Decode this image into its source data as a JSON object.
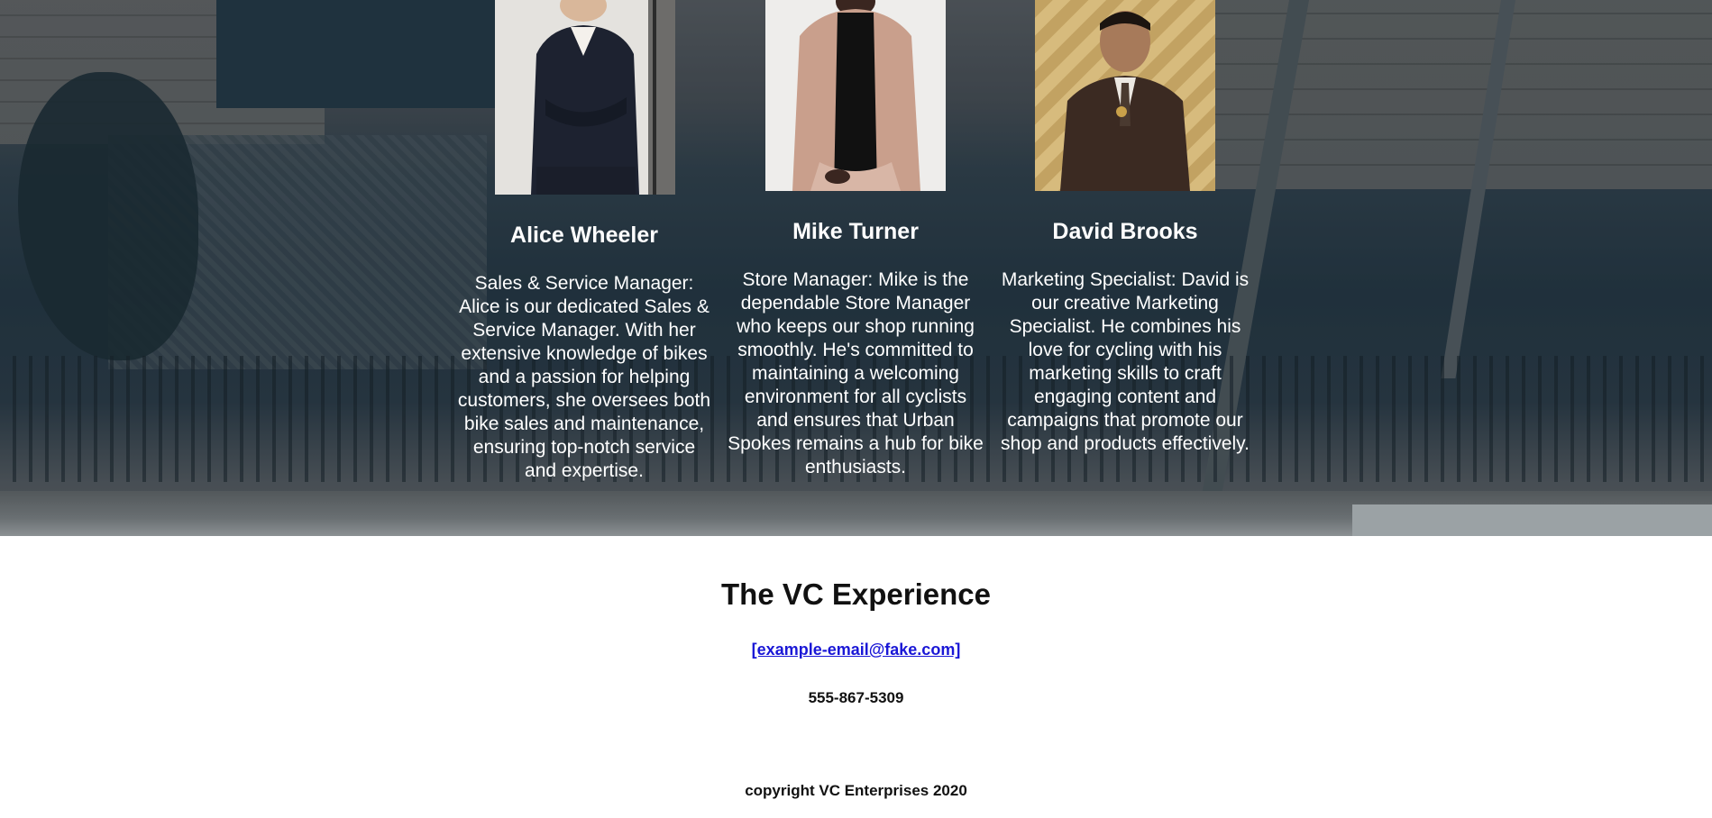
{
  "team": [
    {
      "name": "Alice Wheeler",
      "bio": "Sales & Service Manager: Alice is our dedicated Sales & Service Manager. With her extensive knowledge of bikes and a passion for helping customers, she oversees both bike sales and maintenance, ensuring top-notch service and expertise.",
      "photo_icon": "portrait-woman-blazer"
    },
    {
      "name": "Mike Turner",
      "bio": "Store Manager: Mike is the dependable Store Manager who keeps our shop running smoothly. He's committed to maintaining a welcoming environment for all cyclists and ensures that Urban Spokes remains a hub for bike enthusiasts.",
      "photo_icon": "portrait-man-pink-coat"
    },
    {
      "name": "David Brooks",
      "bio": "Marketing Specialist: David is our creative Marketing Specialist. He combines his love for cycling with his marketing skills to craft engaging content and campaigns that promote our shop and products effectively.",
      "photo_icon": "portrait-man-brown-suit"
    }
  ],
  "footer": {
    "title": "The VC Experience",
    "email": "[example-email@fake.com]",
    "phone": "555-867-5309",
    "copyright": "copyright VC Enterprises 2020"
  },
  "colors": {
    "hero_text": "#ffffff",
    "link": "#1a17d6",
    "footer_text": "#111111"
  }
}
